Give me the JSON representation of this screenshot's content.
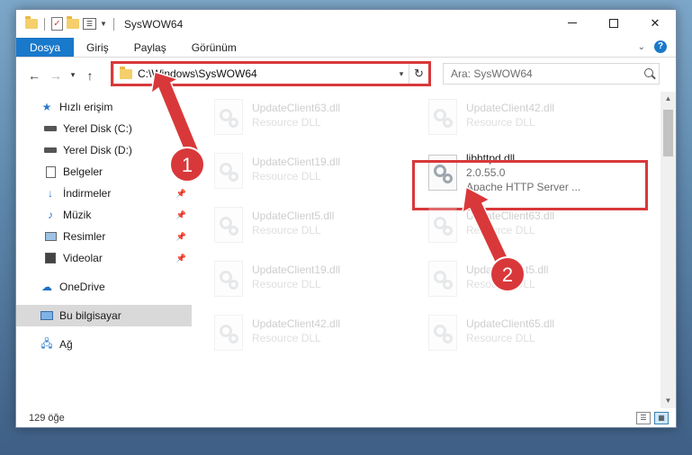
{
  "window": {
    "title": "SysWOW64"
  },
  "ribbon": {
    "tabs": [
      "Dosya",
      "Giriş",
      "Paylaş",
      "Görünüm"
    ]
  },
  "address": {
    "path": "C:\\Windows\\SysWOW64",
    "search_placeholder": "Ara: SysWOW64"
  },
  "sidebar": {
    "items": [
      {
        "label": "Hızlı erişim",
        "icon": "star-icon"
      },
      {
        "label": "Yerel Disk (C:)",
        "icon": "drive-icon"
      },
      {
        "label": "Yerel Disk (D:)",
        "icon": "drive-icon"
      },
      {
        "label": "Belgeler",
        "icon": "documents-icon"
      },
      {
        "label": "İndirmeler",
        "icon": "download-icon"
      },
      {
        "label": "Müzik",
        "icon": "music-icon"
      },
      {
        "label": "Resimler",
        "icon": "pictures-icon"
      },
      {
        "label": "Videolar",
        "icon": "video-icon"
      },
      {
        "label": "OneDrive",
        "icon": "cloud-icon"
      },
      {
        "label": "Bu bilgisayar",
        "icon": "computer-icon"
      },
      {
        "label": "Ağ",
        "icon": "network-icon"
      }
    ]
  },
  "files": [
    {
      "name": "UpdateClient63.dll",
      "sub": "Resource DLL"
    },
    {
      "name": "UpdateClient42.dll",
      "sub": "Resource DLL"
    },
    {
      "name": "UpdateClient19.dll",
      "sub": "Resource DLL"
    },
    {
      "name": "libhttpd.dll",
      "sub": "2.0.55.0",
      "sub2": "Apache HTTP Server ..."
    },
    {
      "name": "UpdateClient5.dll",
      "sub": "Resource DLL"
    },
    {
      "name": "UpdateClient63.dll",
      "sub": "Resource DLL"
    },
    {
      "name": "UpdateClient19.dll",
      "sub": "Resource DLL"
    },
    {
      "name": "UpdateClient5.dll",
      "sub": "Resource DLL"
    },
    {
      "name": "UpdateClient42.dll",
      "sub": "Resource DLL"
    },
    {
      "name": "UpdateClient65.dll",
      "sub": "Resource DLL"
    }
  ],
  "status": {
    "count": "129 öğe"
  },
  "annotations": {
    "badge1": "1",
    "badge2": "2",
    "color": "#d9383a"
  }
}
